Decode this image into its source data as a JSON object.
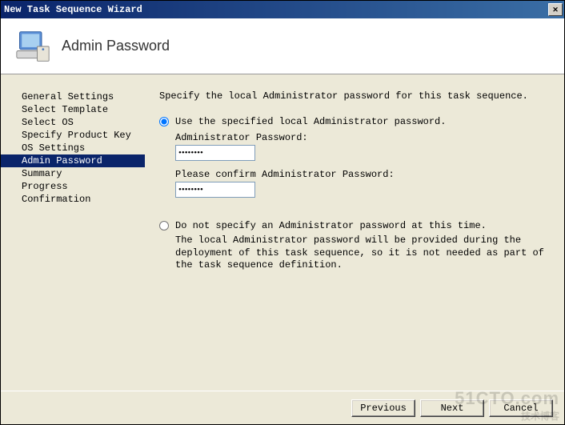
{
  "window": {
    "title": "New Task Sequence Wizard"
  },
  "header": {
    "title": "Admin Password"
  },
  "sidebar": {
    "items": [
      {
        "label": "General Settings"
      },
      {
        "label": "Select Template"
      },
      {
        "label": "Select OS"
      },
      {
        "label": "Specify Product Key"
      },
      {
        "label": "OS Settings"
      },
      {
        "label": "Admin Password"
      },
      {
        "label": "Summary"
      },
      {
        "label": "Progress"
      },
      {
        "label": "Confirmation"
      }
    ],
    "selected_index": 5
  },
  "main": {
    "instruction": "Specify the local Administrator password for this task sequence.",
    "option1": {
      "label": "Use the specified local Administrator password.",
      "pwd_label": "Administrator Password:",
      "pwd_value": "••••••••",
      "confirm_label": "Please confirm Administrator Password:",
      "confirm_value": "••••••••"
    },
    "option2": {
      "label": "Do not specify an Administrator password at this time.",
      "description": "The local Administrator password will be provided during the deployment of this task sequence, so it is not needed as part of the task sequence definition."
    }
  },
  "footer": {
    "previous": "Previous",
    "next": "Next",
    "cancel": "Cancel"
  },
  "watermark": {
    "main": "51CTO.com",
    "sub": "技术博客"
  }
}
